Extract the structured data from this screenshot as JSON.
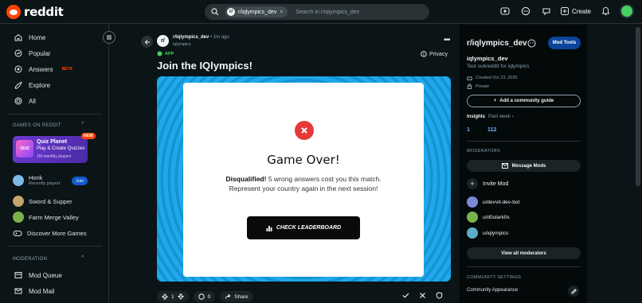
{
  "header": {
    "logo_text": "reddit",
    "search_chip": "r/iqlympics_dev",
    "search_placeholder": "Search in r/iqlympics_dev",
    "create_label": "Create"
  },
  "left_nav": {
    "items": [
      {
        "label": "Home",
        "icon": "home-icon"
      },
      {
        "label": "Popular",
        "icon": "popular-icon"
      },
      {
        "label": "Answers",
        "icon": "answers-icon",
        "badge": "BETA"
      },
      {
        "label": "Explore",
        "icon": "explore-icon"
      },
      {
        "label": "All",
        "icon": "all-icon"
      }
    ],
    "games_section": "GAMES ON REDDIT",
    "featured_game": {
      "title": "Quiz Planet",
      "subtitle": "Play & Create Quizzes",
      "meta": "1M monthly players",
      "icon_text": "QUIZ",
      "badge": "NEW"
    },
    "games": [
      {
        "label": "Honk",
        "sub": "Recently played",
        "action": "Join"
      },
      {
        "label": "Sword & Supper"
      },
      {
        "label": "Farm Merge Valley"
      },
      {
        "label": "Discover More Games"
      }
    ],
    "moderation_section": "MODERATION",
    "mod_items": [
      {
        "label": "Mod Queue"
      },
      {
        "label": "Mod Mail"
      }
    ]
  },
  "post": {
    "subreddit": "r/iqlympics_dev",
    "time": "1m ago",
    "author": "iqlympics",
    "app_tag": "APP",
    "privacy": "Privacy",
    "title": "Join the IQlympics!",
    "modal": {
      "heading": "Game Over!",
      "bold": "Disqualified!",
      "text": " 5 wrong answers cost you this match. Represent your country again in the next session!",
      "button": "CHECK LEADERBOARD"
    },
    "votes": "1",
    "comments": "0",
    "share": "Share"
  },
  "right": {
    "title": "r/iqlympics_dev",
    "mod_tools": "Mod Tools",
    "name": "iqlympics_dev",
    "description": "Test subreddit for iqlympics",
    "created": "Created Oct 23, 2025",
    "visibility": "Private",
    "guide_btn": "Add a community guide",
    "insights": "Insights",
    "insights_period": "Past week",
    "stat_1": "1",
    "stat_2": "112",
    "moderators_label": "MODERATORS",
    "message_mods": "Message Mods",
    "invite_mod": "Invite Mod",
    "mods": [
      "u/devvit-dev-bot",
      "u/d0ulark0s",
      "u/iqlympics"
    ],
    "view_all": "View all moderators",
    "settings_label": "COMMUNITY SETTINGS",
    "community_appearance": "Community Appearance"
  },
  "colors": {
    "accent": "#ff4500",
    "link_blue": "#115bca",
    "error_red": "#e5393a",
    "game_bg": "#1aa6e8"
  }
}
